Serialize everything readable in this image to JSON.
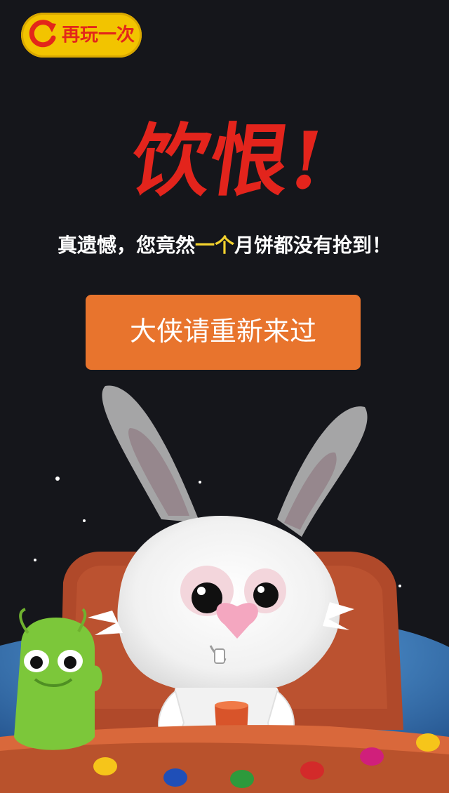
{
  "replay": {
    "label": "再玩一次",
    "icon": "refresh-icon"
  },
  "title": {
    "text": "饮恨!"
  },
  "message": {
    "before": "真遗憾，您竟然",
    "highlight": "一个",
    "after": "月饼都没有抢到！"
  },
  "restart": {
    "label": "大侠请重新来过"
  },
  "colors": {
    "background": "#15161b",
    "replay_fill": "#f2c400",
    "replay_text": "#e3261a",
    "title_red": "#e3241c",
    "highlight_yellow": "#f3d22e",
    "button_orange": "#e8742d",
    "button_text": "#ffffff"
  },
  "icons": [
    "refresh-icon",
    "rabbit-character",
    "green-alien-character",
    "gem-icon"
  ]
}
